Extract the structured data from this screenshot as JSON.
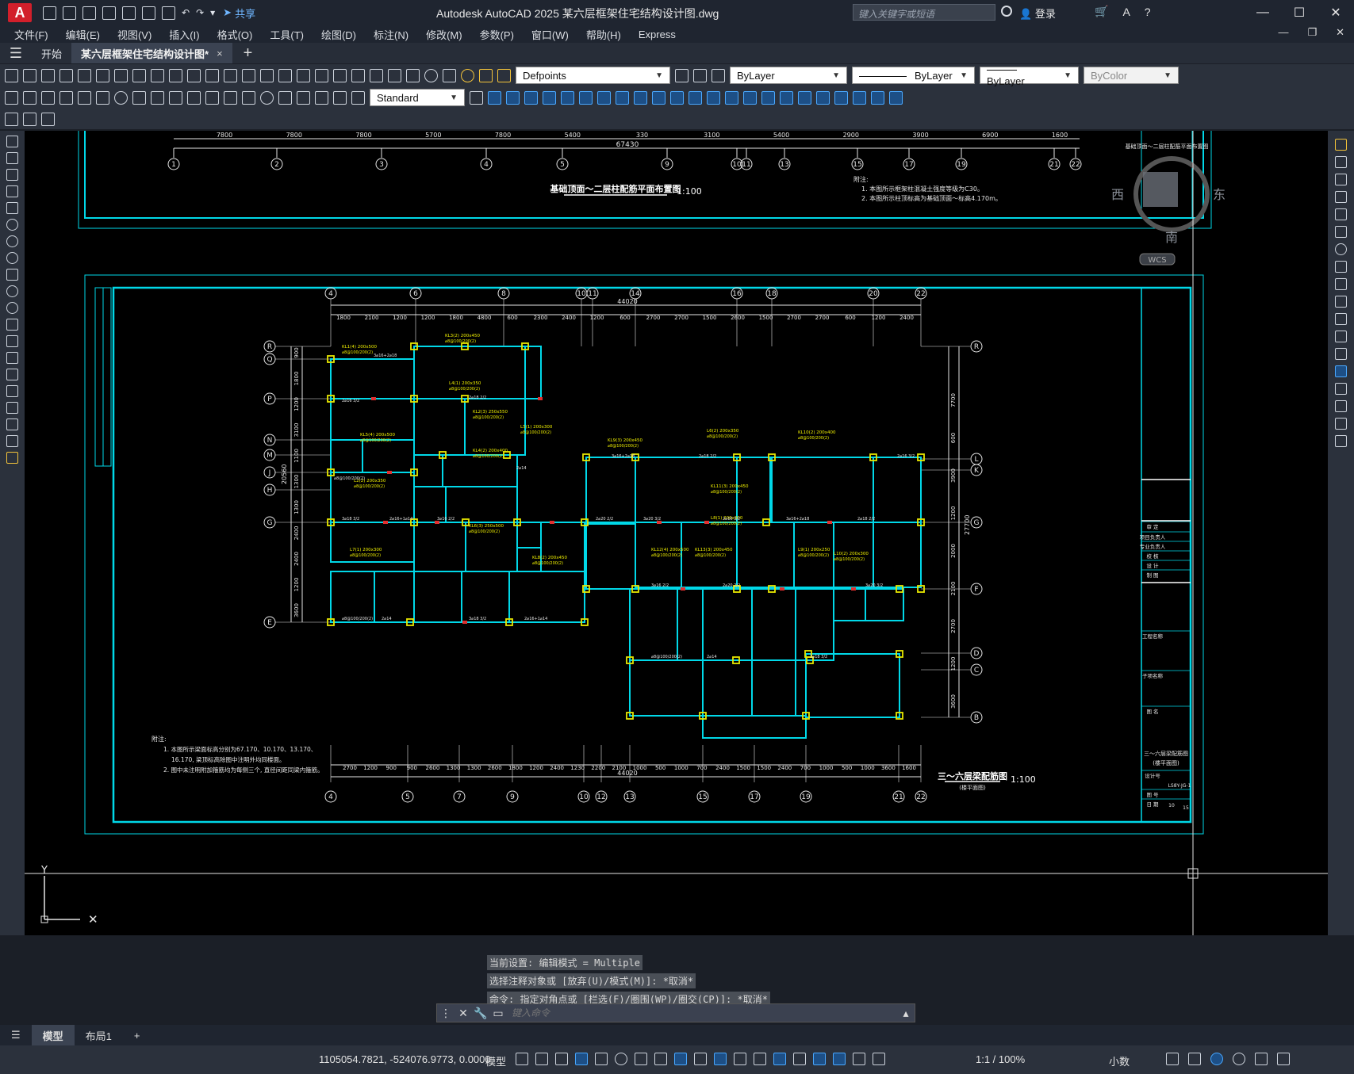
{
  "app": {
    "logo": "A",
    "title": "Autodesk AutoCAD 2025    某六层框架住宅结构设计图.dwg",
    "share_label": "共享",
    "search_placeholder": "键入关键字或短语",
    "login_label": "登录"
  },
  "menu": [
    "文件(F)",
    "编辑(E)",
    "视图(V)",
    "插入(I)",
    "格式(O)",
    "工具(T)",
    "绘图(D)",
    "标注(N)",
    "修改(M)",
    "参数(P)",
    "窗口(W)",
    "帮助(H)",
    "Express"
  ],
  "tabs": {
    "start": "开始",
    "document": "某六层框架住宅结构设计图*",
    "close": "×"
  },
  "toolbar": {
    "layer": "Defpoints",
    "color": "ByLayer",
    "linetype": "ByLayer",
    "lineweight": "ByLayer",
    "plotstyle": "ByColor",
    "text_style": "Standard"
  },
  "viewcube": {
    "west": "西",
    "east": "东",
    "south": "南",
    "wcs": "WCS"
  },
  "drawing": {
    "upper_title": "基础顶面～二层柱配筋平面布置图",
    "upper_scale": "1:100",
    "upper_total": "67430",
    "upper_dims": [
      "7800",
      "7800",
      "7800",
      "5700",
      "7800",
      "5400",
      "330",
      "3100",
      "5400",
      "2900",
      "3900",
      "6900",
      "1600"
    ],
    "upper_axes": [
      "1",
      "2",
      "3",
      "4",
      "5",
      "9",
      "10",
      "11",
      "13",
      "15",
      "17",
      "19",
      "21",
      "22"
    ],
    "upper_notes": [
      "附注:",
      "1. 本图所示框架柱混凝土强度等级为C30。",
      "2. 本图所示柱顶标高为基础顶面～标高4.170m。"
    ],
    "lower_title": "三～六层梁配筋图",
    "lower_subtitle": "(楼平面图)",
    "lower_scale": "1:100",
    "lower_total": "44020",
    "top_axes": [
      "4",
      "6",
      "8",
      "10",
      "11",
      "14",
      "16",
      "18",
      "20",
      "22"
    ],
    "top_dims": [
      "1800",
      "2100",
      "1200",
      "1200",
      "1800",
      "4800",
      "600",
      "2300",
      "2400",
      "1200",
      "600",
      "2700",
      "2700",
      "1500",
      "2600",
      "1500",
      "2700",
      "2700",
      "600",
      "1200",
      "2400"
    ],
    "bottom_axes": [
      "4",
      "5",
      "7",
      "9",
      "10",
      "12",
      "13",
      "15",
      "17",
      "19",
      "21",
      "22"
    ],
    "bottom_dims": [
      "2700",
      "1200",
      "900",
      "900",
      "2600",
      "1300",
      "1300",
      "2600",
      "1800",
      "1200",
      "2400",
      "1230",
      "2200",
      "2100",
      "1000",
      "500",
      "1000",
      "700",
      "2400",
      "1500",
      "1500",
      "2400",
      "700",
      "1000",
      "500",
      "1000",
      "3600",
      "1600"
    ],
    "left_axes": [
      "R",
      "Q",
      "P",
      "N",
      "M",
      "J",
      "H",
      "G",
      "E"
    ],
    "left_dims": [
      "900",
      "1800",
      "1200",
      "3100",
      "1100",
      "1300",
      "1300",
      "2400",
      "2400",
      "1200",
      "3600"
    ],
    "left_total": "20560",
    "right_axes": [
      "R",
      "L",
      "K",
      "G",
      "F",
      "D",
      "C",
      "B"
    ],
    "right_dims": [
      "7700",
      "600",
      "3900",
      "1200",
      "2000",
      "2100",
      "2700",
      "1200",
      "3600"
    ],
    "right_total": "27700",
    "lower_notes": [
      "附注:",
      "1. 本图所示梁面标高分别为67.170、10.170、13.170、",
      "16.170, 梁顶标高除图中注明外均同楼面。",
      "2. 图中未注明附加箍筋均为每侧三个, 直径间距同梁内箍筋。"
    ],
    "titleblock_rows": [
      "审  定",
      "项目负责人",
      "专业负责人",
      "校  核",
      "设  计",
      "制  图",
      "工程名称",
      "子项名称",
      "图  名",
      "设计号",
      "图  号",
      "日  期"
    ],
    "titleblock_drawing_name": "三～六层梁配筋图",
    "titleblock_drawing_sub": "(楼平面图)",
    "titleblock_number": "LS8Y-JG-1",
    "titleblock_sheet": "10",
    "titleblock_total": "15",
    "upper_titleblock_name": "基础顶面～二层柱配筋平面布置图",
    "beam_labels": [
      "KL1(4) 200x500",
      "KL3(2) 200x450",
      "L4(1) 200x350",
      "KL2(3) 250x550",
      "KL4(2) 200x400",
      "L5(1) 200x300",
      "KL5(4) 200x500",
      "L2(2) 200x350",
      "KL6(3) 250x500",
      "L7(1) 200x300",
      "KL8(2) 200x450",
      "KL9(3) 200x450",
      "L6(2) 200x350",
      "KL10(2) 200x400",
      "KL11(3) 200x450",
      "L8(1) 200x300",
      "KL12(4) 200x500",
      "KL13(3) 200x450",
      "L9(1) 200x250",
      "L10(2) 200x300"
    ],
    "rebar_labels": [
      "2⌀16 3/2",
      "3⌀16+2⌀18",
      "2⌀18 2/2",
      "⌀8@100/200(2)",
      "2⌀14",
      "3⌀18 3/2",
      "2⌀16+1⌀14",
      "3⌀16 2/2",
      "2⌀20 2/2",
      "3⌀20 3/2"
    ]
  },
  "command": {
    "history": [
      "当前设置: 编辑模式 = Multiple",
      "选择注释对象或 [放弃(U)/模式(M)]: *取消*",
      "命令: 指定对角点或 [栏选(F)/圈围(WP)/圈交(CP)]: *取消*"
    ],
    "placeholder": "键入命令"
  },
  "layout_tabs": [
    "模型",
    "布局1"
  ],
  "status": {
    "coords": "1105054.7821, -524076.9773, 0.0000",
    "model": "模型",
    "scale": "1:1 / 100%",
    "units": "小数"
  },
  "colors": {
    "frame": "#00d8e8",
    "column": "#e6e600",
    "beam_label": "#f0f000",
    "dimension": "#e6e6e6",
    "accent": "#1e78d2"
  }
}
